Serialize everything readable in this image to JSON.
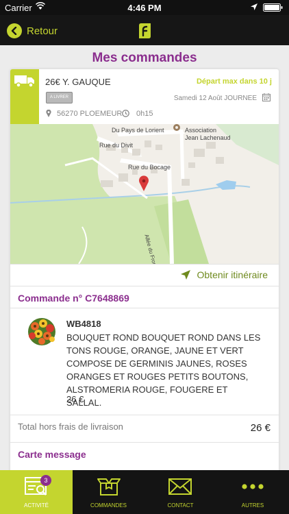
{
  "status_bar": {
    "carrier": "Carrier",
    "time": "4:46 PM"
  },
  "nav": {
    "back_label": "Retour"
  },
  "page": {
    "title": "Mes commandes"
  },
  "order": {
    "amount_client": "26€ Y. GAUQUE",
    "departure": "Départ max dans 10 j",
    "status_badge": "A LIVRER",
    "date": "Samedi 12 Août JOURNEE",
    "city": "56270 PLOEMEUR",
    "duration": "0h15",
    "directions_label": "Obtenir itinéraire",
    "order_number": "Commande n° C7648869",
    "product": {
      "code": "WB4818",
      "description": "BOUQUET ROND BOUQUET ROND DANS LES TONS ROUGE, ORANGE, JAUNE ET VERT COMPOSE DE GERMINIS JAUNES, ROSES ORANGES ET ROUGES PETITS BOUTONS, ALSTROMERIA ROUGE, FOUGERE ET SALLAL.",
      "price": "26 €"
    },
    "total_label": "Total hors frais de livraison",
    "total_value": "26 €",
    "message_title": "Carte message"
  },
  "map": {
    "labels": {
      "pays_de_lorient": "Du Pays de Lorient",
      "association": "Association",
      "association_name": "Jean Lachenaud",
      "rue_du_divit": "Rue du Divit",
      "rue_du_bocage": "Rue du Bocage",
      "allee": "Allée du Front Populaire"
    }
  },
  "tabs": [
    {
      "label": "ACTIVITÉ",
      "badge": "3"
    },
    {
      "label": "COMMANDES"
    },
    {
      "label": "CONTACT"
    },
    {
      "label": "AUTRES"
    }
  ],
  "colors": {
    "accent_green": "#c4d52f",
    "brand_purple": "#8b2e8e",
    "dark_bar": "#141414"
  },
  "icons": [
    "wifi-icon",
    "location-arrow-icon",
    "battery-icon",
    "back-arrow-icon",
    "app-logo-icon",
    "truck-icon",
    "calendar-icon",
    "map-pin-icon",
    "clock-icon",
    "navigation-arrow-icon",
    "activity-icon",
    "box-icon",
    "envelope-icon",
    "more-dots-icon"
  ]
}
